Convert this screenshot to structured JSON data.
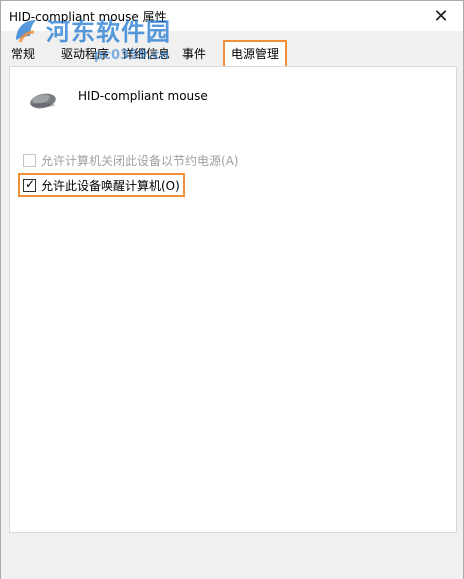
{
  "window": {
    "title": "HID-compliant mouse 属性",
    "close_glyph": "✕"
  },
  "watermark": {
    "brand": "河东软件园",
    "url": "pc0359.cn"
  },
  "tabs": [
    {
      "label": "常规",
      "active": false
    },
    {
      "label": "驱动程序",
      "active": false
    },
    {
      "label": "详细信息",
      "active": false
    },
    {
      "label": "事件",
      "active": false
    },
    {
      "label": "电源管理",
      "active": true
    }
  ],
  "device": {
    "icon": "mouse-icon",
    "name": "HID-compliant mouse"
  },
  "options": [
    {
      "label": "允许计算机关闭此设备以节约电源(A)",
      "checked": false,
      "enabled": false
    },
    {
      "label": "允许此设备唤醒计算机(O)",
      "checked": true,
      "enabled": true
    }
  ],
  "colors": {
    "highlight": "#f0913a",
    "watermark": "#1e78d2"
  }
}
